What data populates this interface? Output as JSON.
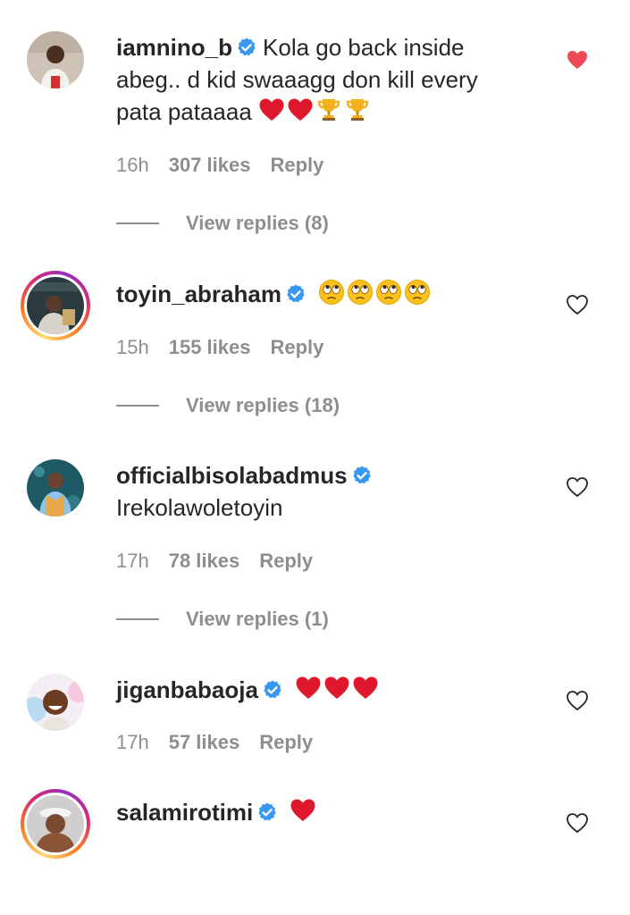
{
  "comments": [
    {
      "username": "iamnino_b",
      "text_line1": "Kola go back inside",
      "text_line2": "abeg.. d kid swaaagg don kill every",
      "text_line3": "pata pataaaa",
      "time": "16h",
      "likes": "307 likes",
      "reply": "Reply",
      "view_replies": "View replies (8)",
      "liked": true
    },
    {
      "username": "toyin_abraham",
      "text": "",
      "time": "15h",
      "likes": "155 likes",
      "reply": "Reply",
      "view_replies": "View replies (18)",
      "liked": false
    },
    {
      "username": "officialbisolabadmus",
      "text": "Irekolawoletoyin",
      "time": "17h",
      "likes": "78 likes",
      "reply": "Reply",
      "view_replies": "View replies (1)",
      "liked": false
    },
    {
      "username": "jiganbabaoja",
      "text": "",
      "time": "17h",
      "likes": "57 likes",
      "reply": "Reply",
      "liked": false
    },
    {
      "username": "salamirotimi",
      "text": "",
      "liked": false
    }
  ],
  "colors": {
    "verified": "#3897f0",
    "liked_heart": "#ed4956",
    "meta_gray": "#8e8e8e",
    "text": "#262626"
  },
  "icons": [
    "verified-badge-icon",
    "heart-icon",
    "heart-outline-icon",
    "red-heart-emoji-icon",
    "trophy-emoji-icon",
    "eye-roll-emoji-icon"
  ]
}
